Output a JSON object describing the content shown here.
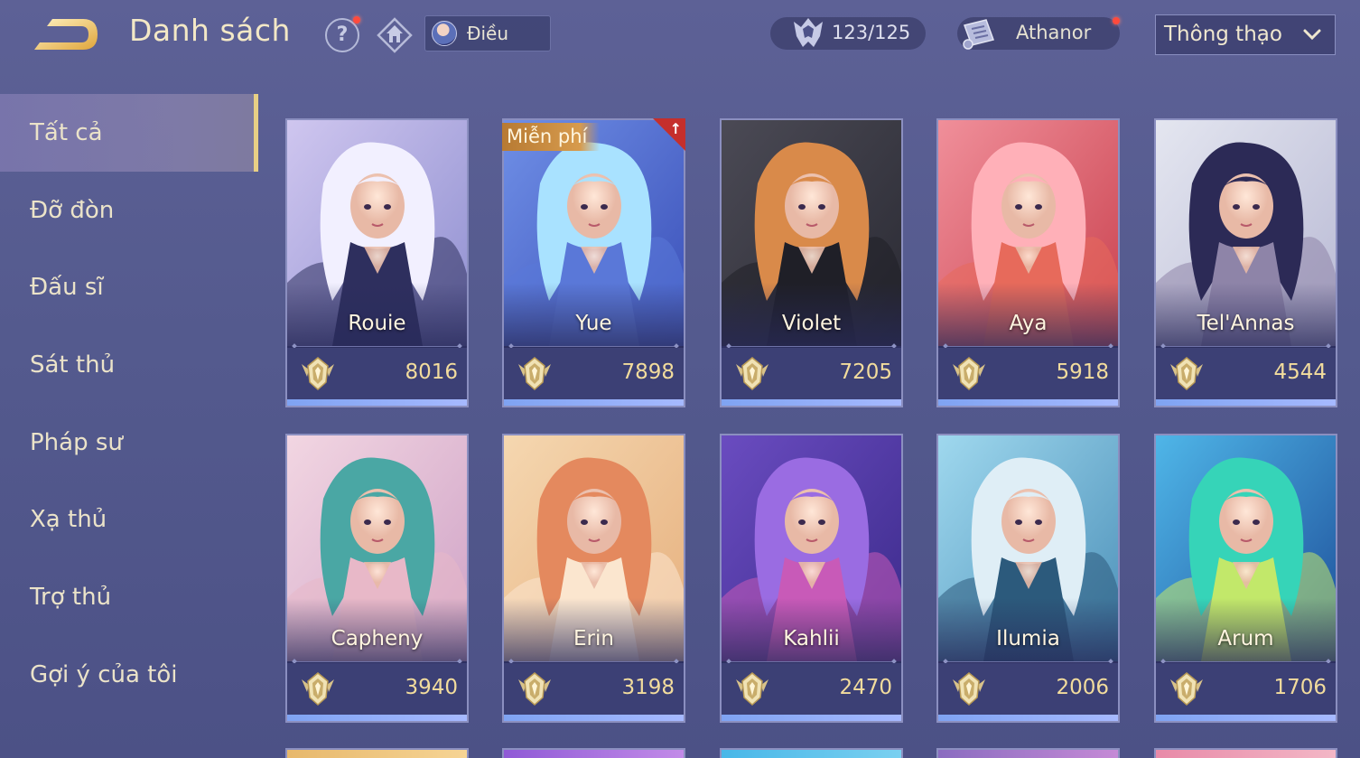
{
  "header": {
    "title": "Danh sách",
    "help_symbol": "?",
    "filter_label": "Điều",
    "hero_count": "123/125",
    "player_name": "Athanor",
    "sort_label": "Thông thạo"
  },
  "sidebar": {
    "items": [
      {
        "label": "Tất cả"
      },
      {
        "label": "Đỡ đòn"
      },
      {
        "label": "Đấu sĩ"
      },
      {
        "label": "Sát thủ"
      },
      {
        "label": "Pháp sư"
      },
      {
        "label": "Xạ thủ"
      },
      {
        "label": "Trợ thủ"
      },
      {
        "label": "Gợi ý của tôi"
      }
    ]
  },
  "heroes": [
    {
      "name": "Rouie",
      "points": "8016",
      "progress": 1.0
    },
    {
      "name": "Yue",
      "points": "7898",
      "progress": 1.0,
      "badge": "Miễn phí"
    },
    {
      "name": "Violet",
      "points": "7205",
      "progress": 1.0
    },
    {
      "name": "Aya",
      "points": "5918",
      "progress": 1.0
    },
    {
      "name": "Tel'Annas",
      "points": "4544",
      "progress": 1.0
    },
    {
      "name": "Capheny",
      "points": "3940",
      "progress": 1.0
    },
    {
      "name": "Erin",
      "points": "3198",
      "progress": 1.0
    },
    {
      "name": "Kahlii",
      "points": "2470",
      "progress": 1.0
    },
    {
      "name": "Ilumia",
      "points": "2006",
      "progress": 1.0
    },
    {
      "name": "Arum",
      "points": "1706",
      "progress": 1.0
    }
  ],
  "colors": {
    "accent_gold": "#e8cf85",
    "points_gold": "#f2dc9d",
    "progress_blue": "#8fa9f5",
    "notify_red": "#ff4a3d"
  },
  "icons": {
    "back": "back-arrow-icon",
    "help": "help-icon",
    "rank": "rank-filter-icon",
    "count": "hero-crest-icon",
    "scroll": "scroll-icon",
    "mastery": "mastery-emblem-icon"
  }
}
